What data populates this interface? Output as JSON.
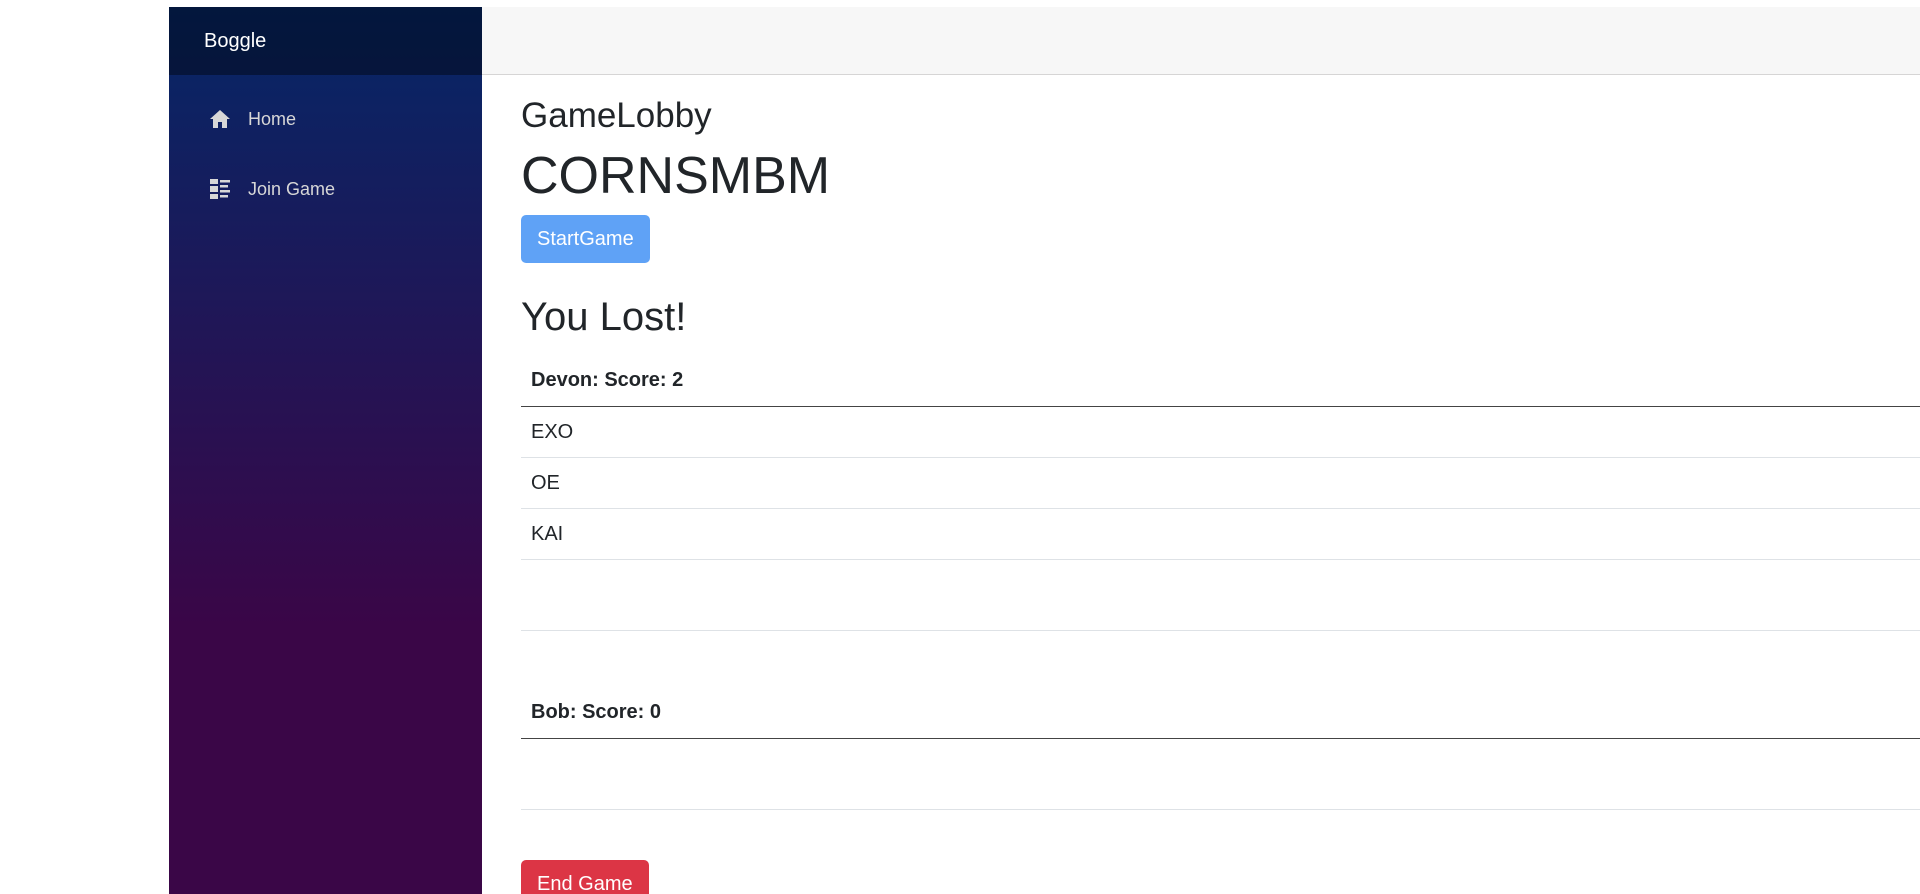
{
  "sidebar": {
    "brand": "Boggle",
    "items": [
      {
        "label": "Home",
        "icon": "home-icon"
      },
      {
        "label": "Join Game",
        "icon": "list-icon"
      }
    ]
  },
  "main": {
    "title": "GameLobby",
    "board_code": "CORNSMBM",
    "start_button": "StartGame",
    "result": "You Lost!",
    "players": [
      {
        "header": "Devon: Score: 2",
        "words": [
          "EXO",
          "OE",
          "KAI"
        ]
      },
      {
        "header": "Bob: Score: 0",
        "words": []
      }
    ],
    "end_button": "End Game"
  },
  "colors": {
    "sidebar_top": "#052767",
    "sidebar_bottom": "#3a0647",
    "start_button": "#5fa2f6",
    "end_button": "#dc3545"
  }
}
